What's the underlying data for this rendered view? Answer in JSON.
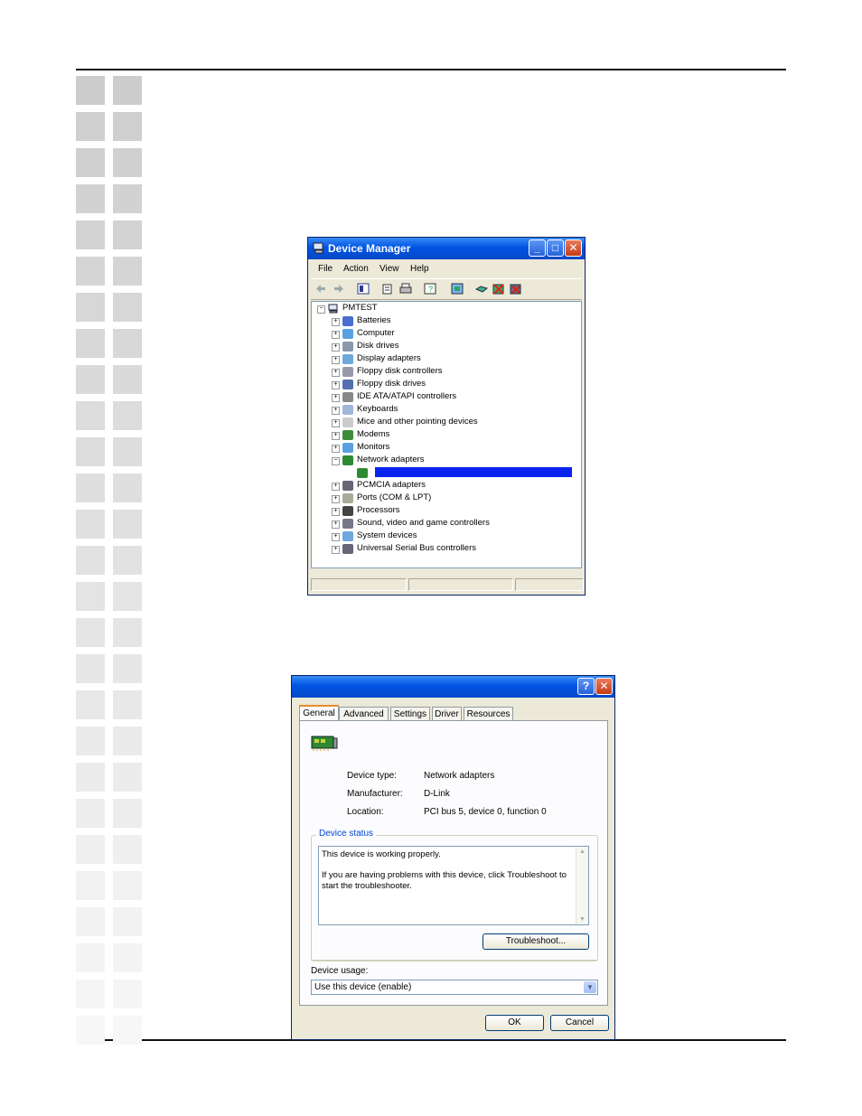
{
  "device_manager": {
    "title": "Device Manager",
    "menu": [
      "File",
      "Action",
      "View",
      "Help"
    ],
    "root": "PMTEST",
    "categories": [
      {
        "label": "Batteries",
        "icon": "battery-icon"
      },
      {
        "label": "Computer",
        "icon": "computer-icon"
      },
      {
        "label": "Disk drives",
        "icon": "disk-drive-icon"
      },
      {
        "label": "Display adapters",
        "icon": "display-adapter-icon"
      },
      {
        "label": "Floppy disk controllers",
        "icon": "floppy-controller-icon"
      },
      {
        "label": "Floppy disk drives",
        "icon": "floppy-drive-icon"
      },
      {
        "label": "IDE ATA/ATAPI controllers",
        "icon": "ide-controller-icon"
      },
      {
        "label": "Keyboards",
        "icon": "keyboard-icon"
      },
      {
        "label": "Mice and other pointing devices",
        "icon": "mouse-icon"
      },
      {
        "label": "Modems",
        "icon": "modem-icon"
      },
      {
        "label": "Monitors",
        "icon": "monitor-icon"
      },
      {
        "label": "Network adapters",
        "icon": "network-adapter-icon",
        "expanded": true
      },
      {
        "label": "",
        "icon": "network-card-icon",
        "selected": true
      },
      {
        "label": "PCMCIA adapters",
        "icon": "pcmcia-icon"
      },
      {
        "label": "Ports (COM & LPT)",
        "icon": "port-icon"
      },
      {
        "label": "Processors",
        "icon": "processor-icon"
      },
      {
        "label": "Sound, video and game controllers",
        "icon": "sound-icon"
      },
      {
        "label": "System devices",
        "icon": "system-device-icon"
      },
      {
        "label": "Universal Serial Bus controllers",
        "icon": "usb-icon"
      }
    ]
  },
  "properties": {
    "tabs": [
      "General",
      "Advanced",
      "Settings",
      "Driver",
      "Resources"
    ],
    "device_type_label": "Device type:",
    "device_type_value": "Network adapters",
    "manufacturer_label": "Manufacturer:",
    "manufacturer_value": "D-Link",
    "location_label": "Location:",
    "location_value": "PCI bus 5, device 0, function 0",
    "status_group_label": "Device status",
    "status_line1": "This device is working properly.",
    "status_line2": "If you are having problems with this device, click Troubleshoot to",
    "status_line3": "start the troubleshooter.",
    "troubleshoot_label": "Troubleshoot...",
    "usage_label": "Device usage:",
    "usage_value": "Use this device (enable)",
    "ok_label": "OK",
    "cancel_label": "Cancel"
  },
  "colors": {
    "title_blue": "#0054e3",
    "selection_blue": "#0a24f0",
    "window_face": "#ece9d8",
    "tab_accent": "#e68b2c"
  }
}
